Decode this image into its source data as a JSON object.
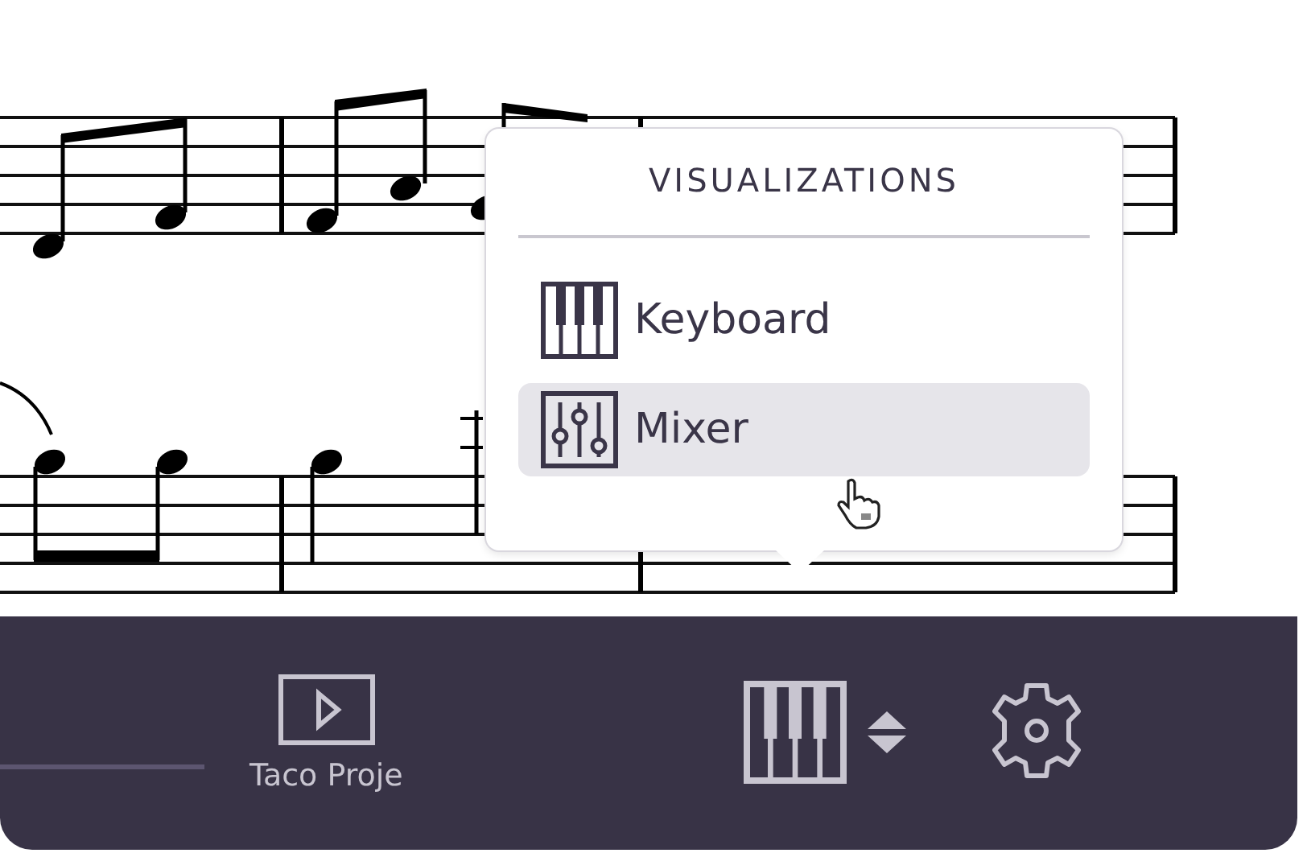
{
  "popover": {
    "title": "VISUALIZATIONS",
    "items": [
      {
        "label": "Keyboard",
        "kind": "keyboard",
        "selected": false
      },
      {
        "label": "Mixer",
        "kind": "mixer",
        "selected": true
      }
    ]
  },
  "toolbar": {
    "project_label": "Taco Proje"
  }
}
